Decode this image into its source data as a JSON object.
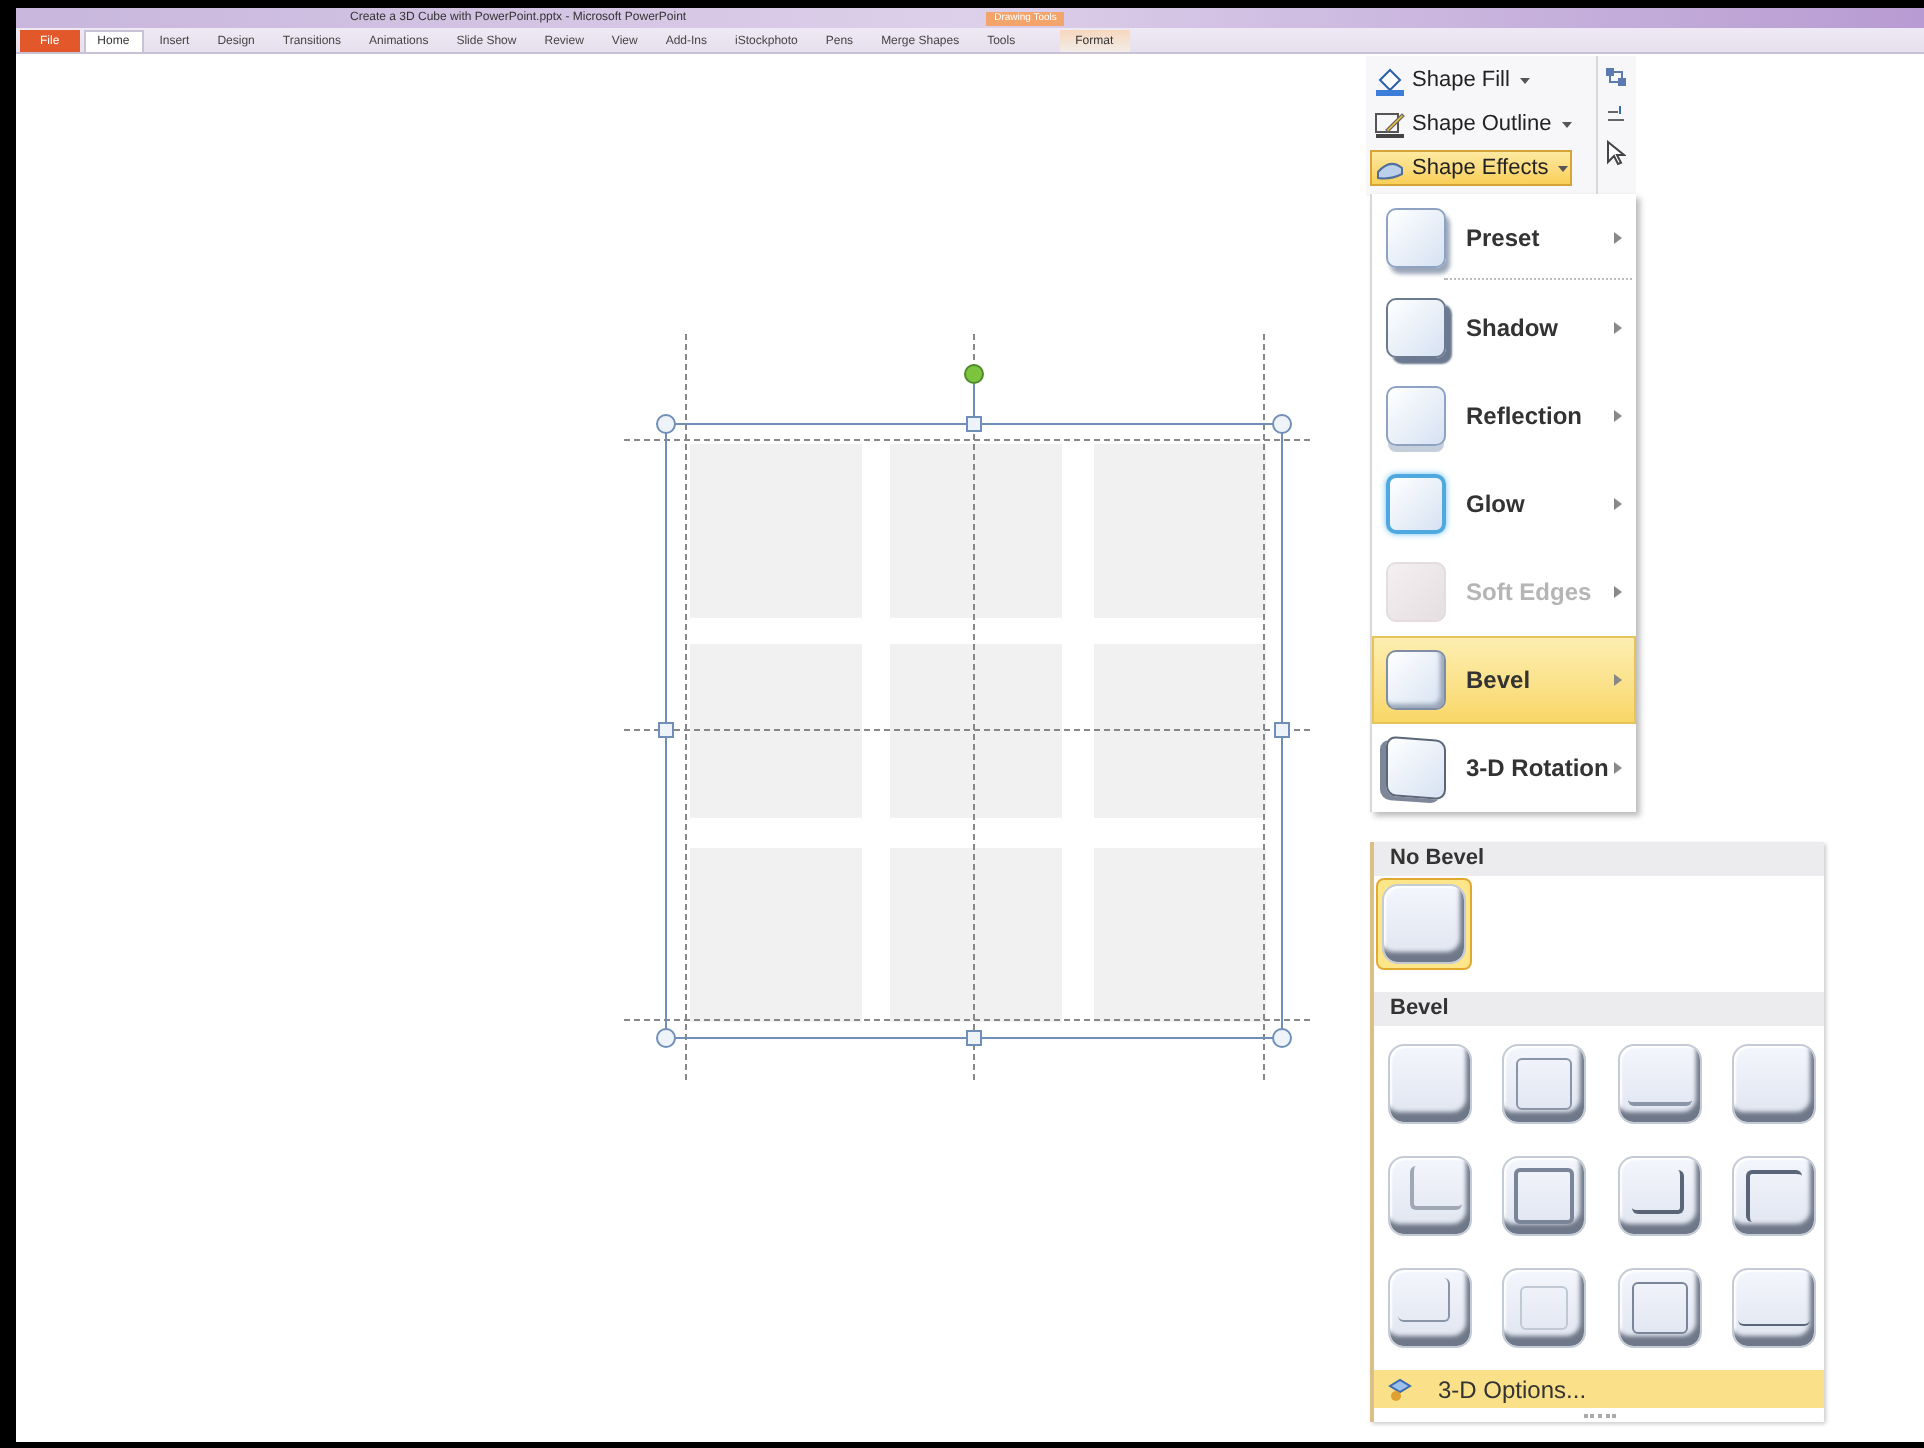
{
  "window": {
    "title": "Create a 3D Cube with PowerPoint.pptx - Microsoft PowerPoint",
    "tool_group": "Drawing Tools"
  },
  "ribbon_tabs": [
    {
      "label": "File",
      "kind": "file",
      "selected": false
    },
    {
      "label": "Home",
      "kind": "tab",
      "selected": true
    },
    {
      "label": "Insert",
      "kind": "tab",
      "selected": false
    },
    {
      "label": "Design",
      "kind": "tab",
      "selected": false
    },
    {
      "label": "Transitions",
      "kind": "tab",
      "selected": false
    },
    {
      "label": "Animations",
      "kind": "tab",
      "selected": false
    },
    {
      "label": "Slide Show",
      "kind": "tab",
      "selected": false
    },
    {
      "label": "Review",
      "kind": "tab",
      "selected": false
    },
    {
      "label": "View",
      "kind": "tab",
      "selected": false
    },
    {
      "label": "Add-Ins",
      "kind": "tab",
      "selected": false
    },
    {
      "label": "iStockphoto",
      "kind": "tab",
      "selected": false
    },
    {
      "label": "Pens",
      "kind": "tab",
      "selected": false
    },
    {
      "label": "Merge Shapes",
      "kind": "tab",
      "selected": false
    },
    {
      "label": "Tools",
      "kind": "tab",
      "selected": false
    },
    {
      "label": "Format",
      "kind": "tool",
      "selected": false
    }
  ],
  "shape_styles": [
    {
      "label": "Shape Fill",
      "kind": "fill",
      "selected": false
    },
    {
      "label": "Shape Outline",
      "kind": "outline",
      "selected": false
    },
    {
      "label": "Shape Effects",
      "kind": "effects",
      "selected": true
    }
  ],
  "effects_menu": [
    {
      "label": "Preset",
      "kind": "preset",
      "selected": false,
      "disabled": false
    },
    {
      "label": "Shadow",
      "kind": "shadow",
      "selected": false,
      "disabled": false
    },
    {
      "label": "Reflection",
      "kind": "reflection",
      "selected": false,
      "disabled": false
    },
    {
      "label": "Glow",
      "kind": "glow",
      "selected": false,
      "disabled": false
    },
    {
      "label": "Soft Edges",
      "kind": "soft",
      "selected": false,
      "disabled": true
    },
    {
      "label": "Bevel",
      "kind": "bevel",
      "selected": true,
      "disabled": false
    },
    {
      "label": "3-D Rotation",
      "kind": "rotation",
      "selected": false,
      "disabled": false
    }
  ],
  "bevel_menu": {
    "no_bevel_heading": "No Bevel",
    "no_bevel": {
      "selected": true
    },
    "bevel_heading": "Bevel",
    "presets": [
      {
        "selected": false
      },
      {
        "selected": false
      },
      {
        "selected": false
      },
      {
        "selected": false
      },
      {
        "selected": false
      },
      {
        "selected": false
      },
      {
        "selected": false
      },
      {
        "selected": false
      },
      {
        "selected": false
      },
      {
        "selected": false
      },
      {
        "selected": false
      },
      {
        "selected": false
      }
    ],
    "options": {
      "label": "3-D Options...",
      "selected": true
    }
  }
}
